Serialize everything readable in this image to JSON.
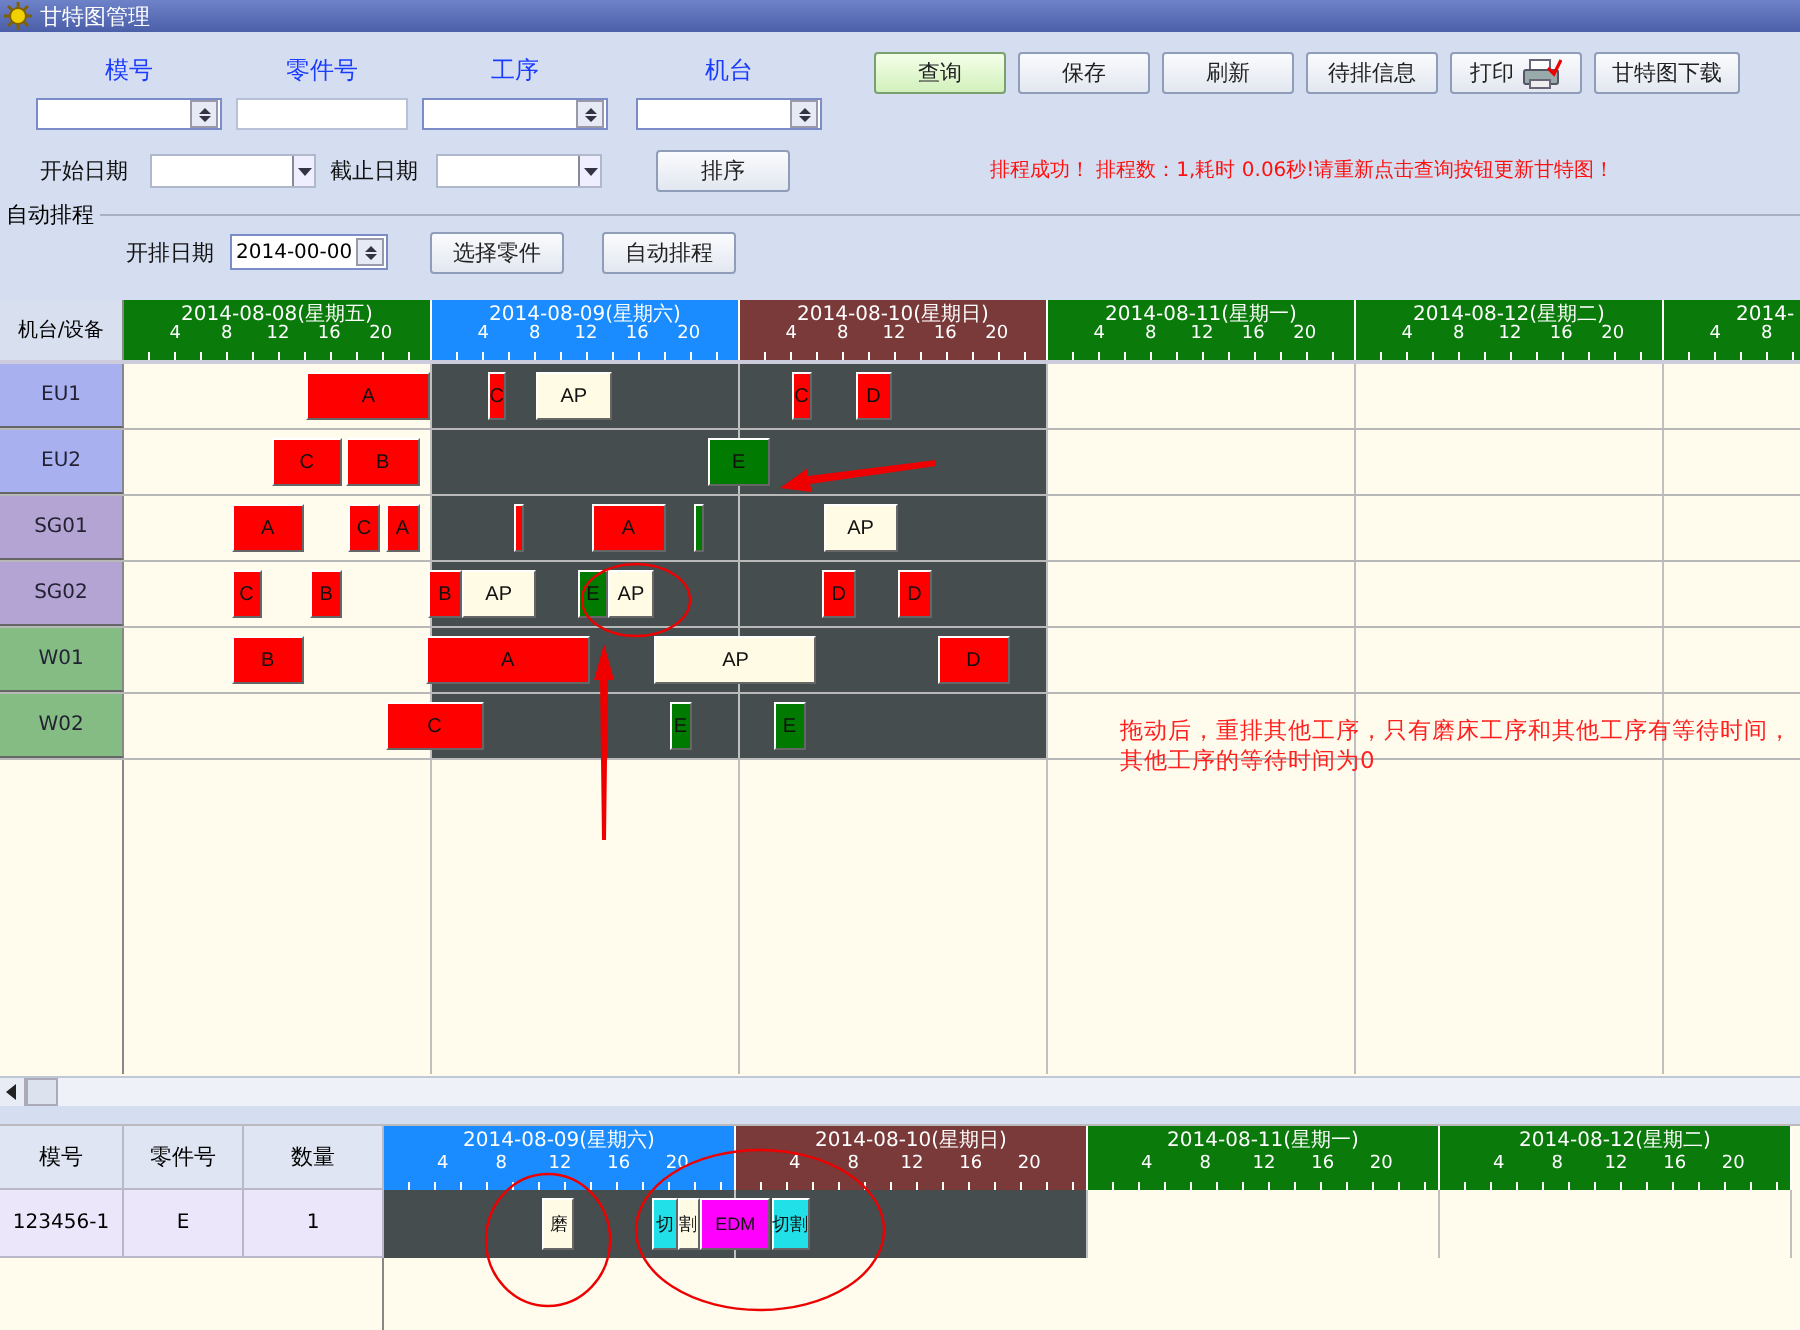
{
  "window": {
    "title": "甘特图管理"
  },
  "filters": [
    {
      "label": "模号",
      "kind": "select"
    },
    {
      "label": "零件号",
      "kind": "text"
    },
    {
      "label": "工序",
      "kind": "select"
    },
    {
      "label": "机台",
      "kind": "select"
    }
  ],
  "buttons": [
    {
      "label": "查询",
      "primary": true,
      "kind": "plain"
    },
    {
      "label": "保存",
      "primary": false,
      "kind": "plain"
    },
    {
      "label": "刷新",
      "primary": false,
      "kind": "plain"
    },
    {
      "label": "待排信息",
      "primary": false,
      "kind": "plain"
    },
    {
      "label": "打印",
      "primary": false,
      "kind": "print"
    },
    {
      "label": "甘特图下载",
      "primary": false,
      "kind": "plain"
    }
  ],
  "date_range": {
    "start_label": "开始日期",
    "end_label": "截止日期",
    "sort_button": "排序"
  },
  "status_message": "排程成功！ 排程数：1,耗时 0.06秒!请重新点击查询按钮更新甘特图！",
  "auto_schedule": {
    "title": "自动排程",
    "date_label": "开排日期",
    "date_value": "2014-00-00",
    "buttons": [
      "选择零件",
      "自动排程"
    ]
  },
  "gantt": {
    "corner": "机台/设备",
    "days": [
      {
        "label": "2014-08-08(星期五)",
        "color": "#0a7a0a",
        "scheduled": false,
        "hours": [
          "4",
          "8",
          "12",
          "16",
          "20"
        ]
      },
      {
        "label": "2014-08-09(星期六)",
        "color": "#1a8cff",
        "scheduled": true,
        "hours": [
          "4",
          "8",
          "12",
          "16",
          "20"
        ]
      },
      {
        "label": "2014-08-10(星期日)",
        "color": "#7a3a3a",
        "scheduled": true,
        "hours": [
          "4",
          "8",
          "12",
          "16",
          "20"
        ]
      },
      {
        "label": "2014-08-11(星期一)",
        "color": "#0a7a0a",
        "scheduled": false,
        "hours": [
          "4",
          "8",
          "12",
          "16",
          "20"
        ]
      },
      {
        "label": "2014-08-12(星期二)",
        "color": "#0a7a0a",
        "scheduled": false,
        "hours": [
          "4",
          "8",
          "12",
          "16",
          "20"
        ]
      },
      {
        "label": "2014-",
        "color": "#0a7a0a",
        "scheduled": false,
        "hours": [
          "4",
          "8"
        ]
      }
    ],
    "rows": [
      {
        "machine": "EU1",
        "color": "#a8b0f0",
        "tasks": [
          {
            "label": "A",
            "color": "#ff0000"
          },
          {
            "label": "C",
            "color": "#ff0000"
          },
          {
            "label": "AP",
            "color": "#fffbe4"
          },
          {
            "label": "C",
            "color": "#ff0000"
          },
          {
            "label": "D",
            "color": "#ff0000"
          }
        ]
      },
      {
        "machine": "EU2",
        "color": "#a8b0f0",
        "tasks": [
          {
            "label": "C",
            "color": "#ff0000"
          },
          {
            "label": "B",
            "color": "#ff0000"
          },
          {
            "label": "E",
            "color": "#007a00"
          }
        ]
      },
      {
        "machine": "SG01",
        "color": "#b4a4d4",
        "tasks": [
          {
            "label": "A",
            "color": "#ff0000"
          },
          {
            "label": "C",
            "color": "#ff0000"
          },
          {
            "label": "A",
            "color": "#ff0000"
          },
          {
            "color": "#ff0000"
          },
          {
            "label": "A",
            "color": "#ff0000"
          },
          {
            "color": "#007a00"
          },
          {
            "label": "AP",
            "color": "#fffbe4"
          }
        ]
      },
      {
        "machine": "SG02",
        "color": "#b4a4d4",
        "tasks": [
          {
            "label": "C",
            "color": "#ff0000"
          },
          {
            "label": "B",
            "color": "#ff0000"
          },
          {
            "label": "B",
            "color": "#ff0000"
          },
          {
            "label": "AP",
            "color": "#fffbe4"
          },
          {
            "label": "E",
            "color": "#007a00"
          },
          {
            "label": "AP",
            "color": "#fffbe4"
          },
          {
            "label": "D",
            "color": "#ff0000"
          },
          {
            "label": "D",
            "color": "#ff0000"
          }
        ]
      },
      {
        "machine": "W01",
        "color": "#84bc84",
        "tasks": [
          {
            "label": "B",
            "color": "#ff0000"
          },
          {
            "label": "A",
            "color": "#ff0000"
          },
          {
            "label": "AP",
            "color": "#fffbe4"
          },
          {
            "label": "D",
            "color": "#ff0000"
          }
        ]
      },
      {
        "machine": "W02",
        "color": "#84bc84",
        "tasks": [
          {
            "label": "C",
            "color": "#ff0000"
          },
          {
            "label": "E",
            "color": "#007a00"
          },
          {
            "label": "E",
            "color": "#007a00"
          }
        ]
      }
    ],
    "annotations": [
      {
        "kind": "ellipse"
      },
      {
        "kind": "arrow"
      },
      {
        "kind": "arrow"
      }
    ],
    "note": "拖动后，重排其他工序，只有磨床工序和其他工序有等待时间，其他工序的等待时间为0"
  },
  "detail": {
    "columns": [
      "模号",
      "零件号",
      "数量"
    ],
    "days": [
      {
        "label": "2014-08-09(星期六)",
        "color": "#1a8cff",
        "scheduled": true,
        "hours": [
          "4",
          "8",
          "12",
          "16",
          "20"
        ]
      },
      {
        "label": "2014-08-10(星期日)",
        "color": "#7a3a3a",
        "scheduled": true,
        "hours": [
          "4",
          "8",
          "12",
          "16",
          "20"
        ]
      },
      {
        "label": "2014-08-11(星期一)",
        "color": "#0a7a0a",
        "scheduled": false,
        "hours": [
          "4",
          "8",
          "12",
          "16",
          "20"
        ]
      },
      {
        "label": "2014-08-12(星期二)",
        "color": "#0a7a0a",
        "scheduled": false,
        "hours": [
          "4",
          "8",
          "12",
          "16",
          "20"
        ]
      }
    ],
    "rows": [
      {
        "cells": [
          "123456-1",
          "E",
          "1"
        ],
        "tasks": [
          {
            "label": "磨",
            "color": "#fffbe4"
          },
          {
            "label": "切",
            "color": "#22e0e8"
          },
          {
            "label": "割",
            "color": "#fffbe4"
          },
          {
            "label": "EDM",
            "color": "#ff00ff"
          },
          {
            "label": "切割",
            "color": "#22e0e8"
          }
        ]
      }
    ],
    "annotations": [
      {
        "kind": "ellipse"
      },
      {
        "kind": "ellipse"
      }
    ]
  }
}
